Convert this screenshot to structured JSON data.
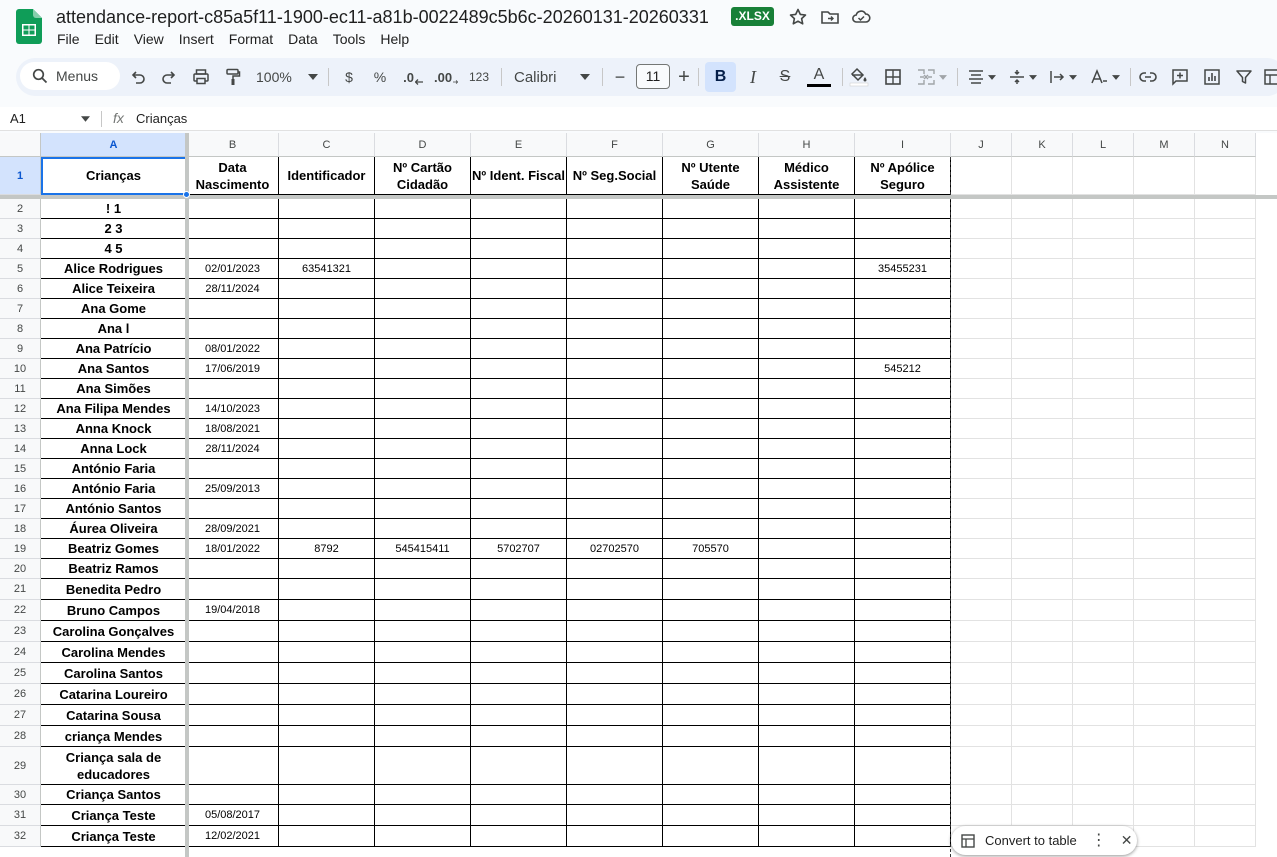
{
  "document": {
    "title": "attendance-report-c85a5f11-1900-ec11-a81b-0022489c5b6c-20260131-20260331",
    "badge": ".XLSX"
  },
  "menu": [
    "File",
    "Edit",
    "View",
    "Insert",
    "Format",
    "Data",
    "Tools",
    "Help"
  ],
  "toolbar": {
    "search_label": "Menus",
    "zoom": "100%",
    "currency": "$",
    "percent": "%",
    "dec_decrease": ".0",
    "dec_increase": ".00",
    "number_format": "123",
    "font": "Calibri",
    "font_size": "11",
    "minus": "−",
    "plus": "+",
    "bold": "B",
    "italic": "I",
    "strike": "S",
    "text_color": "A"
  },
  "formula_bar": {
    "cell_ref": "A1",
    "fx": "fx",
    "value": "Crianças"
  },
  "columns": [
    "A",
    "B",
    "C",
    "D",
    "E",
    "F",
    "G",
    "H",
    "I",
    "J",
    "K",
    "L",
    "M",
    "N"
  ],
  "header_row": [
    "Crianças",
    "Data Nascimento",
    "Identificador",
    "Nº Cartão Cidadão",
    "Nº Ident. Fiscal",
    "Nº Seg.Social",
    "Nº Utente Saúde",
    "Médico Assistente",
    "Nº Apólice Seguro"
  ],
  "rows": [
    {
      "n": "2",
      "cells": [
        "! 1",
        "",
        "",
        "",
        "",
        "",
        "",
        "",
        ""
      ]
    },
    {
      "n": "3",
      "cells": [
        "2 3",
        "",
        "",
        "",
        "",
        "",
        "",
        "",
        ""
      ]
    },
    {
      "n": "4",
      "cells": [
        "4 5",
        "",
        "",
        "",
        "",
        "",
        "",
        "",
        ""
      ]
    },
    {
      "n": "5",
      "cells": [
        "Alice Rodrigues",
        "02/01/2023",
        "63541321",
        "",
        "",
        "",
        "",
        "",
        "35455231"
      ]
    },
    {
      "n": "6",
      "cells": [
        "Alice Teixeira",
        "28/11/2024",
        "",
        "",
        "",
        "",
        "",
        "",
        ""
      ]
    },
    {
      "n": "7",
      "cells": [
        "Ana Gome",
        "",
        "",
        "",
        "",
        "",
        "",
        "",
        ""
      ]
    },
    {
      "n": "8",
      "cells": [
        "Ana l",
        "",
        "",
        "",
        "",
        "",
        "",
        "",
        ""
      ]
    },
    {
      "n": "9",
      "cells": [
        "Ana Patrício",
        "08/01/2022",
        "",
        "",
        "",
        "",
        "",
        "",
        ""
      ]
    },
    {
      "n": "10",
      "cells": [
        "Ana Santos",
        "17/06/2019",
        "",
        "",
        "",
        "",
        "",
        "",
        "545212"
      ]
    },
    {
      "n": "11",
      "cells": [
        "Ana Simões",
        "",
        "",
        "",
        "",
        "",
        "",
        "",
        ""
      ]
    },
    {
      "n": "12",
      "cells": [
        "Ana Filipa Mendes",
        "14/10/2023",
        "",
        "",
        "",
        "",
        "",
        "",
        ""
      ]
    },
    {
      "n": "13",
      "cells": [
        "Anna Knock",
        "18/08/2021",
        "",
        "",
        "",
        "",
        "",
        "",
        ""
      ]
    },
    {
      "n": "14",
      "cells": [
        "Anna Lock",
        "28/11/2024",
        "",
        "",
        "",
        "",
        "",
        "",
        ""
      ]
    },
    {
      "n": "15",
      "cells": [
        "António Faria",
        "",
        "",
        "",
        "",
        "",
        "",
        "",
        ""
      ]
    },
    {
      "n": "16",
      "cells": [
        "António Faria",
        "25/09/2013",
        "",
        "",
        "",
        "",
        "",
        "",
        ""
      ]
    },
    {
      "n": "17",
      "cells": [
        "António Santos",
        "",
        "",
        "",
        "",
        "",
        "",
        "",
        ""
      ]
    },
    {
      "n": "18",
      "cells": [
        "Áurea Oliveira",
        "28/09/2021",
        "",
        "",
        "",
        "",
        "",
        "",
        ""
      ]
    },
    {
      "n": "19",
      "cells": [
        "Beatriz Gomes",
        "18/01/2022",
        "8792",
        "545415411",
        "5702707",
        "02702570",
        "705570",
        "",
        ""
      ]
    },
    {
      "n": "20",
      "cells": [
        "Beatriz Ramos",
        "",
        "",
        "",
        "",
        "",
        "",
        "",
        ""
      ]
    },
    {
      "n": "21",
      "cells": [
        "Benedita Pedro",
        "",
        "",
        "",
        "",
        "",
        "",
        "",
        ""
      ]
    },
    {
      "n": "22",
      "cells": [
        "Bruno Campos",
        "19/04/2018",
        "",
        "",
        "",
        "",
        "",
        "",
        ""
      ]
    },
    {
      "n": "23",
      "cells": [
        "Carolina Gonçalves",
        "",
        "",
        "",
        "",
        "",
        "",
        "",
        ""
      ]
    },
    {
      "n": "24",
      "cells": [
        "Carolina Mendes",
        "",
        "",
        "",
        "",
        "",
        "",
        "",
        ""
      ]
    },
    {
      "n": "25",
      "cells": [
        "Carolina Santos",
        "",
        "",
        "",
        "",
        "",
        "",
        "",
        ""
      ]
    },
    {
      "n": "26",
      "cells": [
        "Catarina Loureiro",
        "",
        "",
        "",
        "",
        "",
        "",
        "",
        ""
      ]
    },
    {
      "n": "27",
      "cells": [
        "Catarina Sousa",
        "",
        "",
        "",
        "",
        "",
        "",
        "",
        ""
      ]
    },
    {
      "n": "28",
      "cells": [
        "criança Mendes",
        "",
        "",
        "",
        "",
        "",
        "",
        "",
        ""
      ]
    },
    {
      "n": "29",
      "cells": [
        "Criança sala de educadores",
        "",
        "",
        "",
        "",
        "",
        "",
        "",
        ""
      ]
    },
    {
      "n": "30",
      "cells": [
        "Criança Santos",
        "",
        "",
        "",
        "",
        "",
        "",
        "",
        ""
      ]
    },
    {
      "n": "31",
      "cells": [
        "Criança Teste",
        "05/08/2017",
        "",
        "",
        "",
        "",
        "",
        "",
        ""
      ]
    },
    {
      "n": "32",
      "cells": [
        "Criança Teste",
        "12/02/2021",
        "",
        "",
        "",
        "",
        "",
        "",
        ""
      ]
    }
  ],
  "convert_chip": {
    "label": "Convert to table",
    "more": "⋮",
    "close": "✕"
  },
  "colors": {
    "accent": "#1a73e8",
    "badge": "#188038",
    "toolbar_bg": "#edf2fa",
    "selected_header": "#d3e3fd"
  }
}
